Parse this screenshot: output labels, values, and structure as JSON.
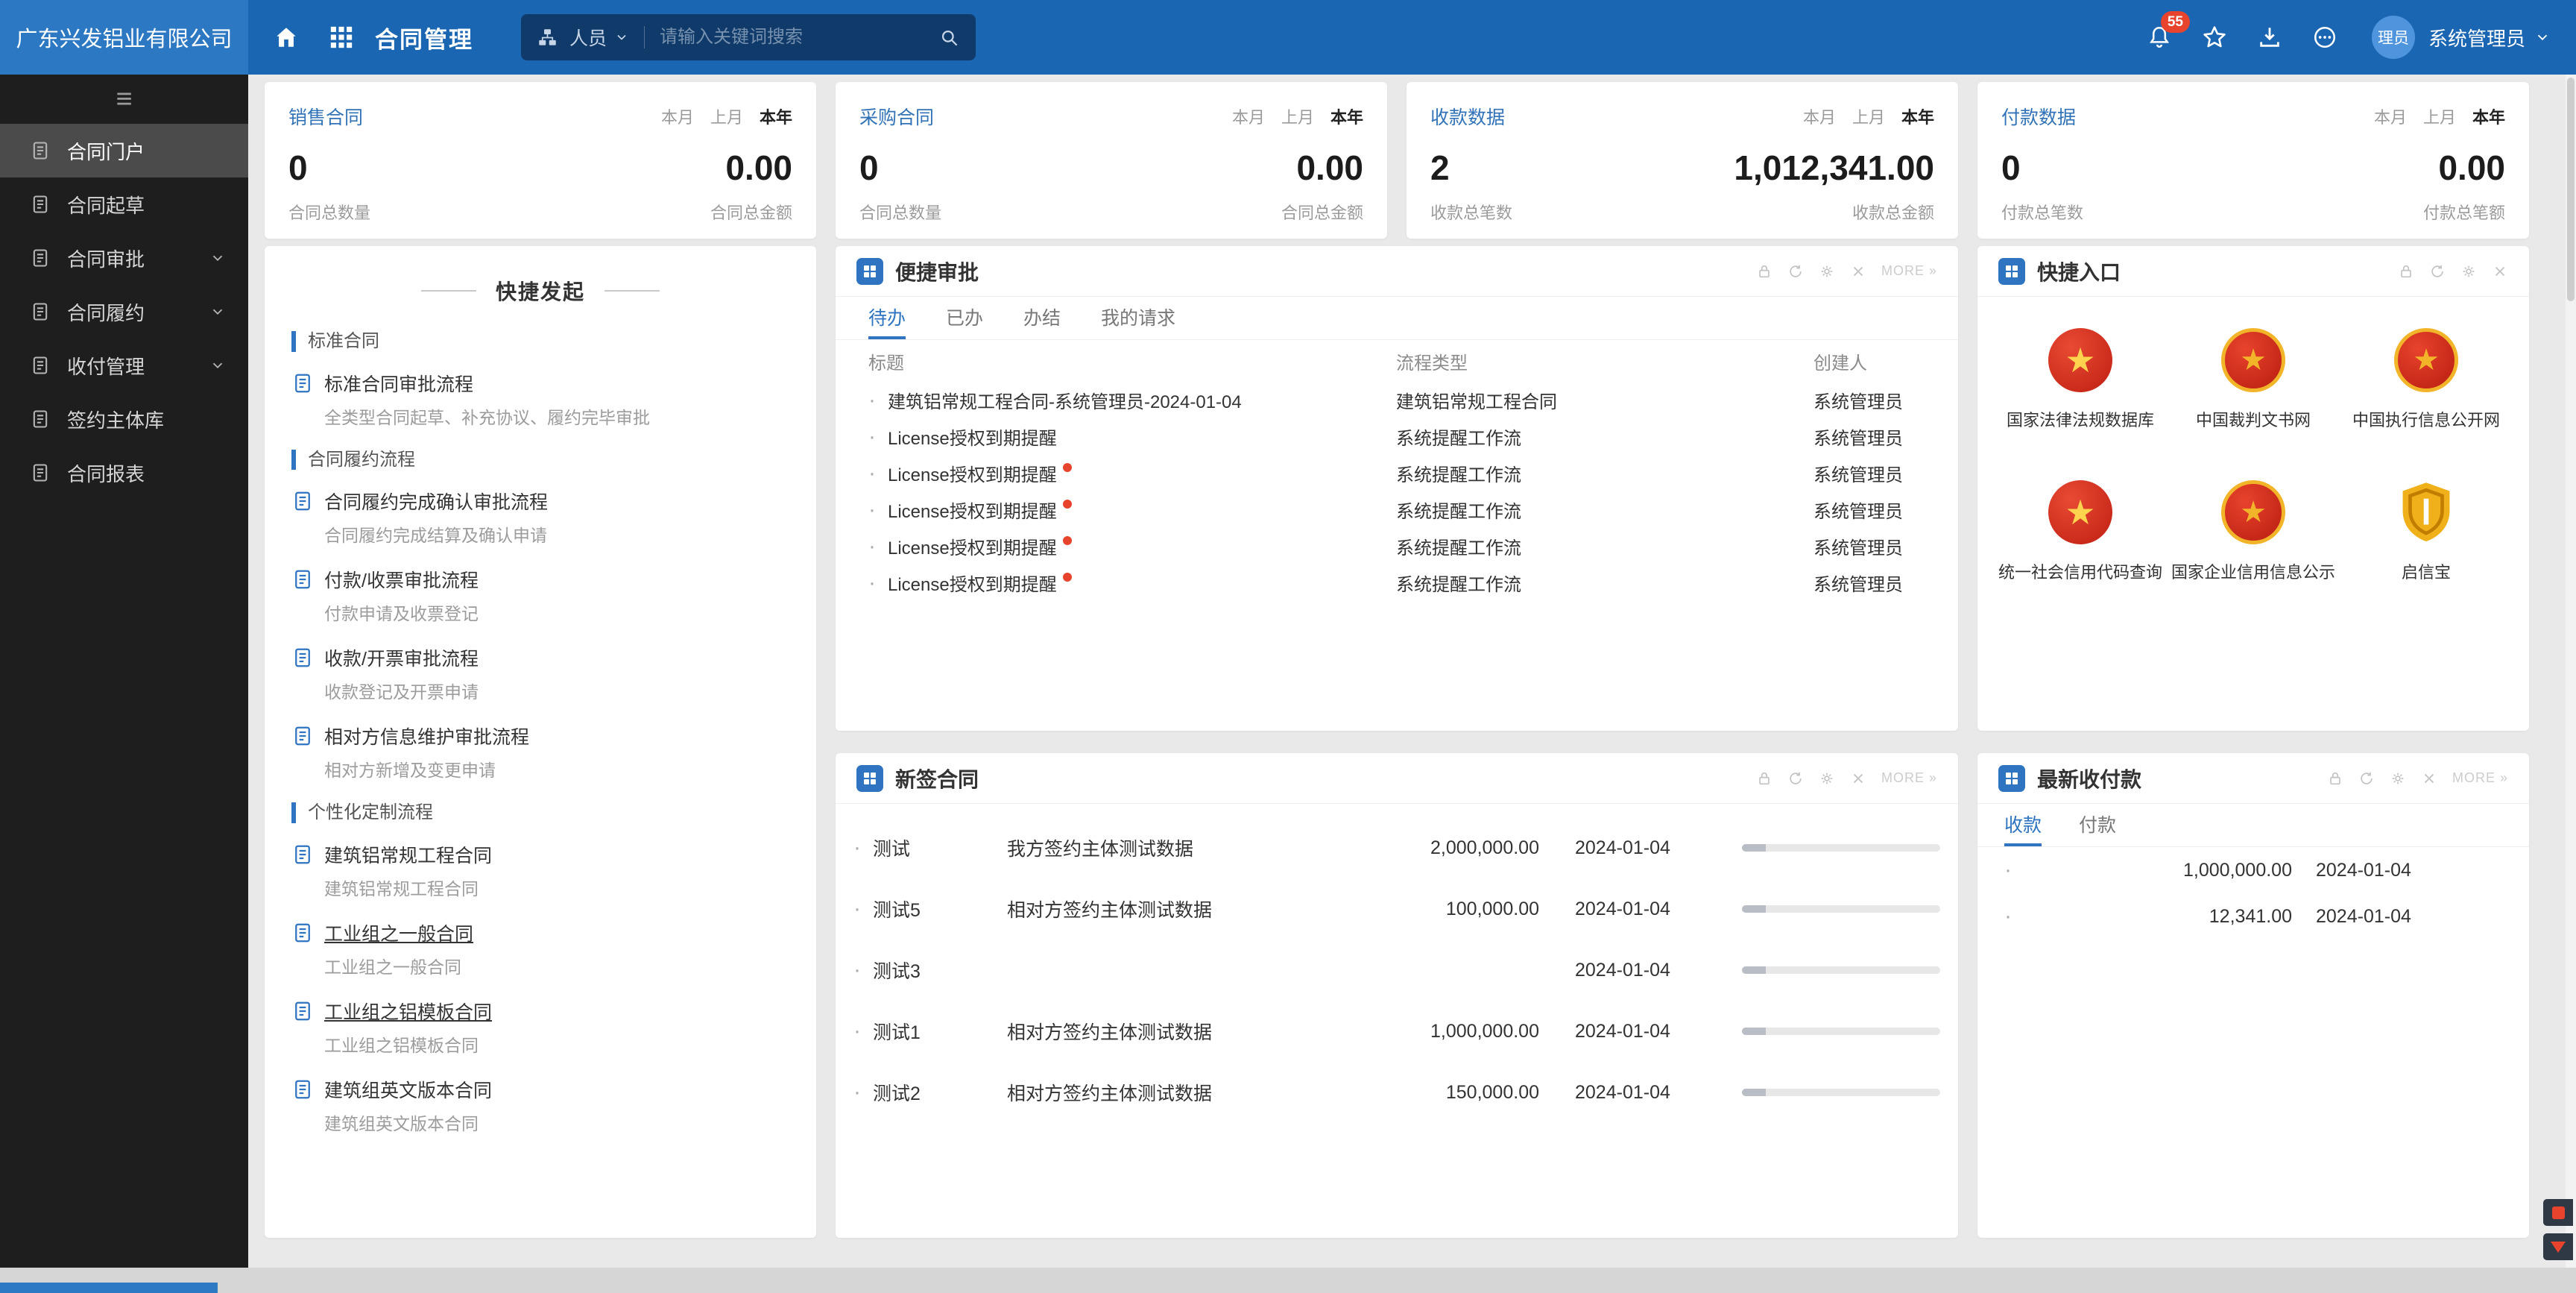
{
  "header": {
    "company": "广东兴发铝业有限公司",
    "app_title": "合同管理",
    "people_label": "人员",
    "search_placeholder": "请输入关键词搜索",
    "notification_count": "55",
    "avatar_text": "理员",
    "user_name": "系统管理员"
  },
  "sidebar": {
    "items": [
      {
        "label": "合同门户"
      },
      {
        "label": "合同起草"
      },
      {
        "label": "合同审批"
      },
      {
        "label": "合同履约"
      },
      {
        "label": "收付管理"
      },
      {
        "label": "签约主体库"
      },
      {
        "label": "合同报表"
      }
    ]
  },
  "stats": [
    {
      "title": "销售合同",
      "tabs": [
        "本月",
        "上月",
        "本年"
      ],
      "active_tab": "本年",
      "count": "0",
      "amount": "0.00",
      "count_label": "合同总数量",
      "amount_label": "合同总金额"
    },
    {
      "title": "采购合同",
      "tabs": [
        "本月",
        "上月",
        "本年"
      ],
      "active_tab": "本年",
      "count": "0",
      "amount": "0.00",
      "count_label": "合同总数量",
      "amount_label": "合同总金额"
    },
    {
      "title": "收款数据",
      "tabs": [
        "本月",
        "上月",
        "本年"
      ],
      "active_tab": "本年",
      "count": "2",
      "amount": "1,012,341.00",
      "count_label": "收款总笔数",
      "amount_label": "收款总金额"
    },
    {
      "title": "付款数据",
      "tabs": [
        "本月",
        "上月",
        "本年"
      ],
      "active_tab": "本年",
      "count": "0",
      "amount": "0.00",
      "count_label": "付款总笔数",
      "amount_label": "付款总笔额"
    }
  ],
  "quick_start": {
    "title": "快捷发起",
    "sections": [
      {
        "label": "标准合同",
        "items": [
          {
            "title": "标准合同审批流程",
            "desc": "全类型合同起草、补充协议、履约完毕审批"
          }
        ]
      },
      {
        "label": "合同履约流程",
        "items": [
          {
            "title": "合同履约完成确认审批流程",
            "desc": "合同履约完成结算及确认申请"
          },
          {
            "title": "付款/收票审批流程",
            "desc": "付款申请及收票登记"
          },
          {
            "title": "收款/开票审批流程",
            "desc": "收款登记及开票申请"
          },
          {
            "title": "相对方信息维护审批流程",
            "desc": "相对方新增及变更申请"
          }
        ]
      },
      {
        "label": "个性化定制流程",
        "items": [
          {
            "title": "建筑铝常规工程合同",
            "desc": "建筑铝常规工程合同"
          },
          {
            "title": "工业组之一般合同",
            "desc": "工业组之一般合同"
          },
          {
            "title": "工业组之铝模板合同",
            "desc": "工业组之铝模板合同"
          },
          {
            "title": "建筑组英文版本合同",
            "desc": "建筑组英文版本合同"
          }
        ]
      }
    ]
  },
  "quick_approval": {
    "title": "便捷审批",
    "more_label": "MORE »",
    "tabs": [
      "待办",
      "已办",
      "办结",
      "我的请求"
    ],
    "columns": [
      "标题",
      "流程类型",
      "创建人"
    ],
    "rows": [
      {
        "title": "建筑铝常规工程合同-系统管理员-2024-01-04",
        "type": "建筑铝常规工程合同",
        "creator": "系统管理员",
        "alert": false
      },
      {
        "title": "License授权到期提醒",
        "type": "系统提醒工作流",
        "creator": "系统管理员",
        "alert": false
      },
      {
        "title": "License授权到期提醒",
        "type": "系统提醒工作流",
        "creator": "系统管理员",
        "alert": true
      },
      {
        "title": "License授权到期提醒",
        "type": "系统提醒工作流",
        "creator": "系统管理员",
        "alert": true
      },
      {
        "title": "License授权到期提醒",
        "type": "系统提醒工作流",
        "creator": "系统管理员",
        "alert": true
      },
      {
        "title": "License授权到期提醒",
        "type": "系统提醒工作流",
        "creator": "系统管理员",
        "alert": true
      }
    ]
  },
  "quick_links": {
    "title": "快捷入口",
    "links": [
      {
        "label": "国家法律法规数据库",
        "icon": "national-emblem-icon"
      },
      {
        "label": "中国裁判文书网",
        "icon": "court-seal-icon"
      },
      {
        "label": "中国执行信息公开网",
        "icon": "court-seal-icon"
      },
      {
        "label": "统一社会信用代码查询",
        "icon": "national-emblem-icon"
      },
      {
        "label": "国家企业信用信息公示",
        "icon": "court-seal-icon"
      },
      {
        "label": "启信宝",
        "icon": "gold-shield-icon"
      }
    ]
  },
  "new_contracts": {
    "title": "新签合同",
    "more_label": "MORE »",
    "rows": [
      {
        "name": "测试",
        "party": "我方签约主体测试数据",
        "amount": "2,000,000.00",
        "date": "2024-01-04"
      },
      {
        "name": "测试5",
        "party": "相对方签约主体测试数据",
        "amount": "100,000.00",
        "date": "2024-01-04"
      },
      {
        "name": "测试3",
        "party": "",
        "amount": "",
        "date": "2024-01-04"
      },
      {
        "name": "测试1",
        "party": "相对方签约主体测试数据",
        "amount": "1,000,000.00",
        "date": "2024-01-04"
      },
      {
        "name": "测试2",
        "party": "相对方签约主体测试数据",
        "amount": "150,000.00",
        "date": "2024-01-04"
      }
    ]
  },
  "latest_payments": {
    "title": "最新收付款",
    "more_label": "MORE »",
    "tabs": [
      "收款",
      "付款"
    ],
    "rows": [
      {
        "amount": "1,000,000.00",
        "date": "2024-01-04"
      },
      {
        "amount": "12,341.00",
        "date": "2024-01-04"
      }
    ]
  }
}
